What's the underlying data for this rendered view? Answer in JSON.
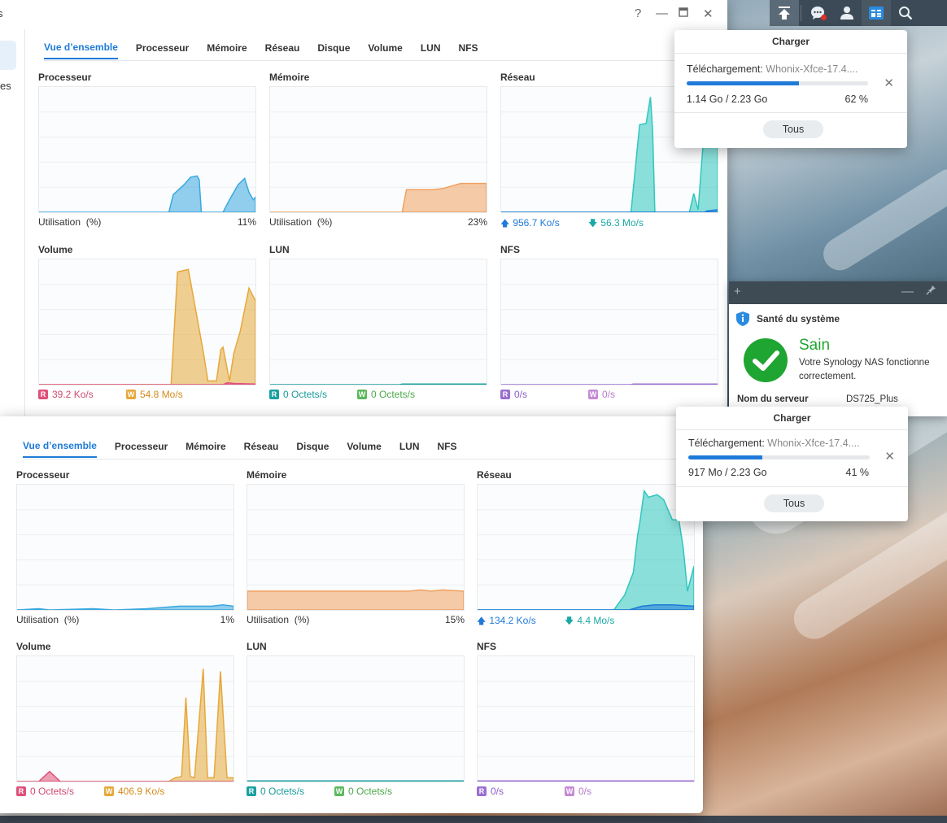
{
  "window_title": "s",
  "sidebar_text": "es",
  "taskbar": {
    "icons": [
      "upload-icon",
      "notifications-icon",
      "user-icon",
      "resource-monitor-icon",
      "search-icon"
    ]
  },
  "win1": {
    "tabs": [
      "Vue d’ensemble",
      "Processeur",
      "Mémoire",
      "Réseau",
      "Disque",
      "Volume",
      "LUN",
      "NFS"
    ],
    "active_tab": "Vue d’ensemble",
    "panels": {
      "cpu": {
        "title": "Processeur",
        "label": "Utilisation",
        "unit": "(%)",
        "value": "11%"
      },
      "mem": {
        "title": "Mémoire",
        "label": "Utilisation",
        "unit": "(%)",
        "value": "23%"
      },
      "net": {
        "title": "Réseau",
        "up": "956.7 Ko/s",
        "down": "56.3 Mo/s"
      },
      "vol": {
        "title": "Volume",
        "r": "39.2 Ko/s",
        "w": "54.8 Mo/s"
      },
      "lun": {
        "title": "LUN",
        "r": "0 Octets/s",
        "w": "0 Octets/s"
      },
      "nfs": {
        "title": "NFS",
        "r": "0/s",
        "w": "0/s"
      }
    }
  },
  "win2": {
    "tabs": [
      "Vue d’ensemble",
      "Processeur",
      "Mémoire",
      "Réseau",
      "Disque",
      "Volume",
      "LUN",
      "NFS"
    ],
    "active_tab": "Vue d’ensemble",
    "panels": {
      "cpu": {
        "title": "Processeur",
        "label": "Utilisation",
        "unit": "(%)",
        "value": "1%"
      },
      "mem": {
        "title": "Mémoire",
        "label": "Utilisation",
        "unit": "(%)",
        "value": "15%"
      },
      "net": {
        "title": "Réseau",
        "up": "134.2 Ko/s",
        "down": "4.4 Mo/s"
      },
      "vol": {
        "title": "Volume",
        "r": "0 Octets/s",
        "w": "406.9 Ko/s"
      },
      "lun": {
        "title": "LUN",
        "r": "0 Octets/s",
        "w": "0 Octets/s"
      },
      "nfs": {
        "title": "NFS",
        "r": "0/s",
        "w": "0/s"
      }
    }
  },
  "badges": {
    "r": "R",
    "w": "W"
  },
  "upload1": {
    "title": "Charger",
    "label": "Téléchargement:",
    "file": "Whonix-Xfce-17.4....",
    "size": "1.14 Go / 2.23 Go",
    "percent": "62 %",
    "progress": 0.62,
    "all_button": "Tous"
  },
  "upload2": {
    "title": "Charger",
    "label": "Téléchargement:",
    "file": "Whonix-Xfce-17.4....",
    "size": "917 Mo / 2.23 Go",
    "percent": "41 %",
    "progress": 0.41,
    "all_button": "Tous"
  },
  "health": {
    "title": "Santé du système",
    "status": "Sain",
    "message": "Votre Synology NAS fonctionne correctement.",
    "server_label": "Nom du serveur",
    "server_name": "DS725_Plus"
  },
  "colors": {
    "cpu": "#3aa8e0",
    "mem": "#f0a060",
    "net": "#2ec7be",
    "net_line": "#1f7ad8",
    "vol_w": "#e6a83a",
    "vol_r": "#e0507a",
    "lun": "#1aa0a0",
    "nfs": "#9b6fd0",
    "accent": "#1f7ad8",
    "ok": "#1fa531",
    "lun_w": "#5cb85c",
    "nfs_w": "#c58ad6"
  }
}
